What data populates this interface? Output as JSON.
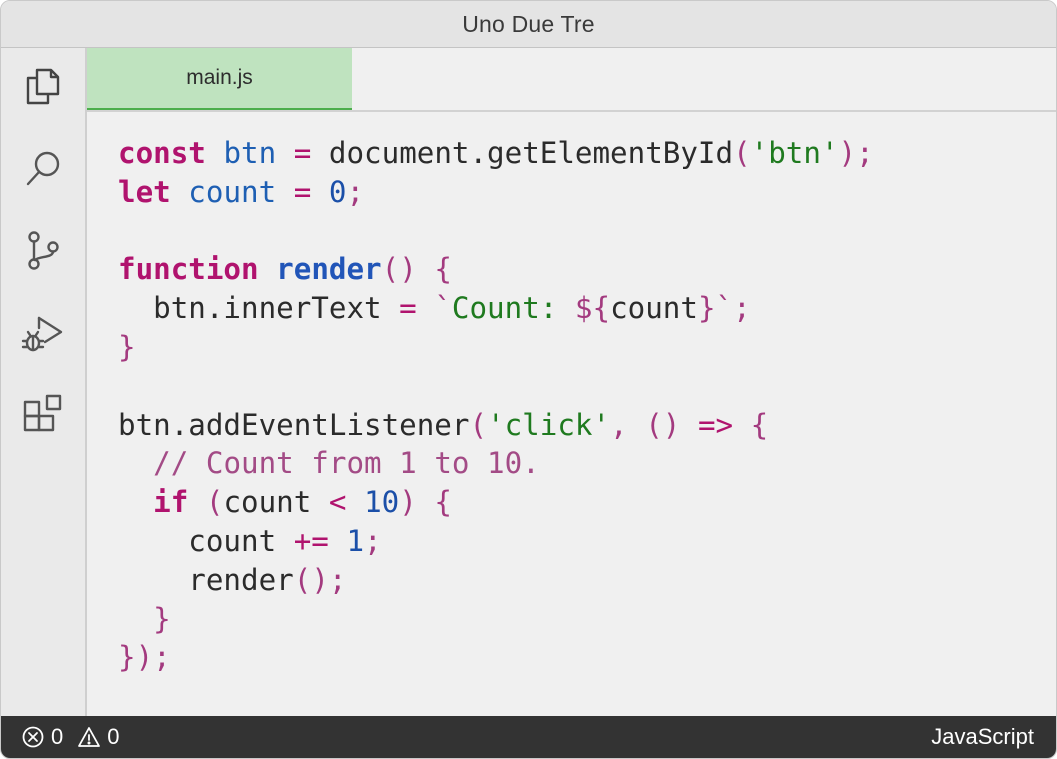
{
  "window": {
    "title": "Uno Due Tre"
  },
  "activity_bar": {
    "items": [
      {
        "icon": "explorer-icon"
      },
      {
        "icon": "search-icon"
      },
      {
        "icon": "source-control-icon"
      },
      {
        "icon": "run-debug-icon"
      },
      {
        "icon": "extensions-icon"
      }
    ]
  },
  "editor": {
    "tabs": [
      {
        "label": "main.js",
        "active": true
      }
    ],
    "language": "javascript",
    "code_lines": [
      "const btn = document.getElementById('btn');",
      "let count = 0;",
      "",
      "function render() {",
      "  btn.innerText = `Count: ${count}`;",
      "}",
      "",
      "btn.addEventListener('click', () => {",
      "  // Count from 1 to 10.",
      "  if (count < 10) {",
      "    count += 1;",
      "    render();",
      "  }",
      "});"
    ]
  },
  "status_bar": {
    "errors": "0",
    "warnings": "0",
    "language_mode": "JavaScript"
  },
  "colors": {
    "keyword": "#b0136e",
    "variable": "#1e5fb3",
    "string": "#1f7a1f",
    "number": "#1b4fa8",
    "comment": "#a34b86",
    "tab_active_bg": "#bfe3bf",
    "tab_active_border": "#4cae4c",
    "status_bar_bg": "#333333"
  }
}
